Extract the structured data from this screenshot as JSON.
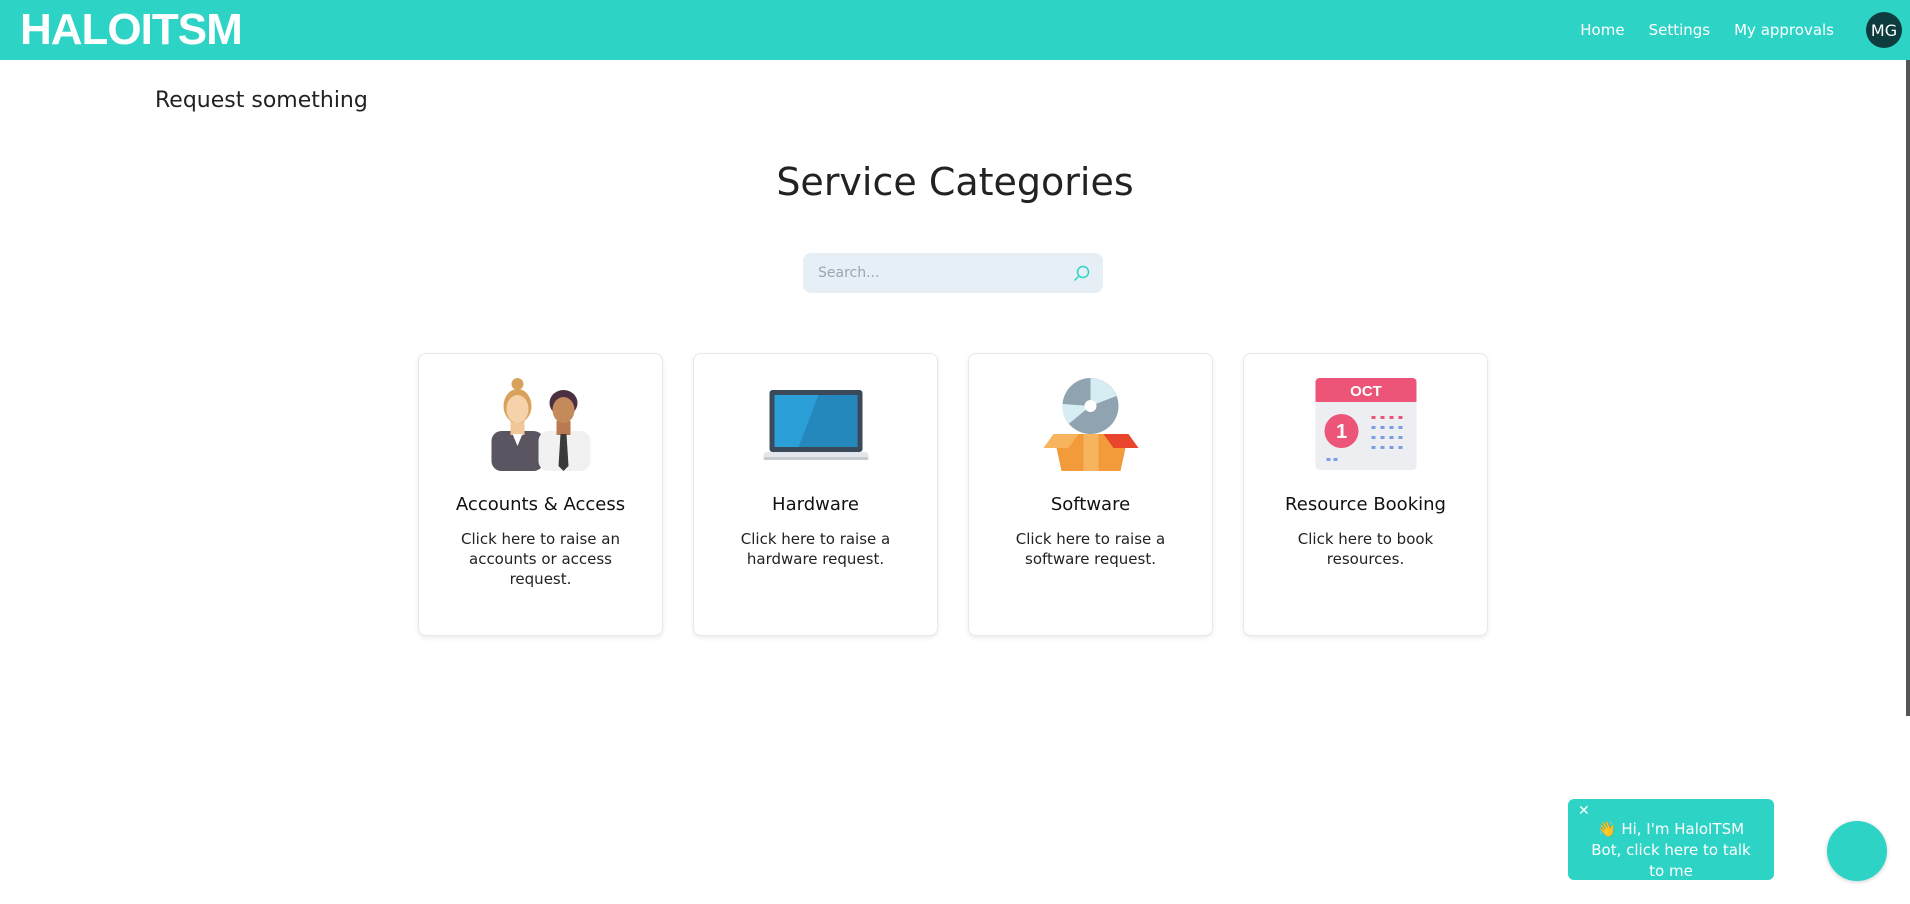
{
  "header": {
    "logo": "HALOITSM",
    "nav": [
      "Home",
      "Settings",
      "My approvals"
    ],
    "avatar_initials": "MG",
    "brand_color": "#2dd4c6"
  },
  "main": {
    "page_title": "Request something",
    "heading": "Service Categories",
    "search": {
      "placeholder": "Search...",
      "value": ""
    },
    "cards": [
      {
        "title": "Accounts & Access",
        "description": "Click here to raise an accounts or access request.",
        "icon": "people-icon"
      },
      {
        "title": "Hardware",
        "description": "Click here to raise a hardware request.",
        "icon": "laptop-icon"
      },
      {
        "title": "Software",
        "description": "Click here to raise a software request.",
        "icon": "software-box-icon"
      },
      {
        "title": "Resource Booking",
        "description": "Click here to book resources.",
        "icon": "calendar-icon",
        "calendar_month": "OCT",
        "calendar_day": "1"
      }
    ]
  },
  "chatbot": {
    "close": "✕",
    "message": "👋 Hi, I'm HaloITSM Bot, click here to talk to me"
  }
}
